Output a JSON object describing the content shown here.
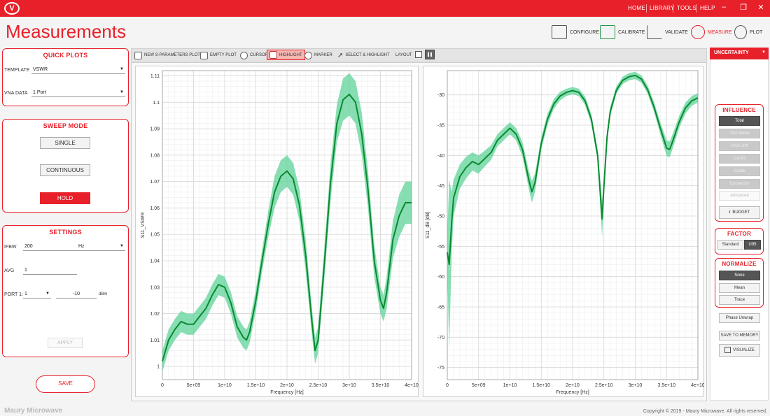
{
  "topbar": {
    "nav": [
      "HOME",
      "LIBRARY",
      "TOOLS",
      "HELP"
    ],
    "window_controls": [
      "minimize-icon",
      "restore-icon",
      "close-icon"
    ]
  },
  "page_title": "Measurements",
  "workflow": [
    {
      "label": "CONFIGURE",
      "icon": "configure-icon"
    },
    {
      "label": "CALIBRATE",
      "icon": "calibrate-icon"
    },
    {
      "label": "VALIDATE",
      "icon": "validate-icon"
    },
    {
      "label": "MEASURE",
      "icon": "measure-icon",
      "active": true
    },
    {
      "label": "PLOT",
      "icon": "plot-icon"
    }
  ],
  "quick_plots": {
    "title": "QUICK PLOTS",
    "template_label": "TEMPLATE",
    "template_value": "VSWR",
    "vna_label": "VNA DATA",
    "vna_value": "1 Port"
  },
  "sweep_mode": {
    "title": "SWEEP MODE",
    "single": "SINGLE",
    "continuous": "CONTINUOUS",
    "hold": "HOLD"
  },
  "settings": {
    "title": "SETTINGS",
    "ifbw_label": "IFBW",
    "ifbw_value": "200",
    "ifbw_unit": "Hz",
    "avg_label": "AVG",
    "avg_value": "1",
    "port_label": "PORT 1:",
    "port_value": "1",
    "power_value": "-10",
    "power_unit": "dBm",
    "apply": "APPLY"
  },
  "save": "SAVE",
  "toolbar": {
    "new_plot": "NEW S-PARAMETERS PLOT",
    "empty_plot": "EMPTY PLOT",
    "cursor": "CURSOR",
    "highlight": "HIGHLIGHT",
    "marker": "MARKER",
    "select_highlight": "SELECT & HIGHLIGHT",
    "layout": "LAYOUT"
  },
  "uncertainty": {
    "title": "UNCERTAINTY",
    "influence_title": "INFLUENCE",
    "influence": [
      "Total",
      "VNA Noise",
      "VNA Drift",
      "Cal Kit",
      "Cable",
      "Connector",
      "Advanced"
    ],
    "budget": "BUDGET",
    "factor_title": "FACTOR",
    "factor_standard": "Standard",
    "factor_u95": "U95",
    "normalize_title": "NORMALIZE",
    "normalize": [
      "None",
      "Mean",
      "Trace"
    ],
    "phase_unwrap": "Phase Unwrap",
    "save_memory": "SAVE TO MEMORY",
    "visualize": "VISUALIZE"
  },
  "footer": {
    "brand": "Maury Microwave",
    "copyright": "Copyright © 2019 - Maury Microwave. All rights reserved."
  },
  "colors": {
    "accent": "#e8202a",
    "trace": "#0a8a2e",
    "band": "#5fd39a"
  },
  "chart_data": [
    {
      "type": "line",
      "xlabel": "Frequency [Hz]",
      "ylabel": "S11_VSWR",
      "xlim": [
        0,
        40000000000
      ],
      "ylim": [
        0.995,
        1.112
      ],
      "xticks": [
        0,
        5000000000,
        10000000000,
        15000000000,
        20000000000,
        25000000000,
        30000000000,
        35000000000,
        40000000000
      ],
      "xtick_labels": [
        "0",
        "5e+09",
        "1e+10",
        "1.5e+10",
        "2e+10",
        "2.5e+10",
        "3e+10",
        "3.5e+10",
        "4e+10"
      ],
      "yticks": [
        1,
        1.01,
        1.02,
        1.03,
        1.04,
        1.05,
        1.06,
        1.07,
        1.08,
        1.09,
        1.1,
        1.11
      ],
      "ytick_labels": [
        "1",
        "1.01",
        "1.02",
        "1.03",
        "1.04",
        "1.05",
        "1.06",
        "1.07",
        "1.08",
        "1.09",
        "1.1",
        "1.11"
      ],
      "grid": true,
      "series": [
        {
          "x": [
            0,
            1000000000,
            2000000000,
            3000000000,
            4000000000,
            5000000000,
            6000000000,
            7000000000,
            8000000000,
            9000000000,
            10000000000,
            11000000000,
            12000000000,
            13000000000,
            13500000000,
            14000000000,
            15000000000,
            16000000000,
            17000000000,
            18000000000,
            19000000000,
            20000000000,
            21000000000,
            22000000000,
            23000000000,
            24000000000,
            24500000000,
            25000000000,
            26000000000,
            27000000000,
            28000000000,
            29000000000,
            30000000000,
            31000000000,
            32000000000,
            33000000000,
            34000000000,
            35000000000,
            35500000000,
            36000000000,
            37000000000,
            38000000000,
            39000000000,
            40000000000
          ],
          "y": [
            1.002,
            1.01,
            1.014,
            1.017,
            1.016,
            1.016,
            1.019,
            1.022,
            1.027,
            1.031,
            1.03,
            1.024,
            1.015,
            1.011,
            1.01,
            1.013,
            1.025,
            1.04,
            1.054,
            1.066,
            1.072,
            1.074,
            1.071,
            1.061,
            1.042,
            1.017,
            1.006,
            1.01,
            1.039,
            1.07,
            1.092,
            1.101,
            1.103,
            1.1,
            1.088,
            1.067,
            1.04,
            1.025,
            1.022,
            1.028,
            1.048,
            1.057,
            1.062,
            1.062
          ],
          "band": [
            0.004,
            0.004,
            0.004,
            0.004,
            0.004,
            0.004,
            0.004,
            0.004,
            0.004,
            0.004,
            0.004,
            0.004,
            0.004,
            0.004,
            0.004,
            0.004,
            0.004,
            0.004,
            0.005,
            0.006,
            0.006,
            0.006,
            0.006,
            0.006,
            0.006,
            0.005,
            0.005,
            0.005,
            0.006,
            0.007,
            0.007,
            0.008,
            0.008,
            0.008,
            0.008,
            0.007,
            0.006,
            0.005,
            0.005,
            0.006,
            0.007,
            0.008,
            0.008,
            0.008
          ]
        }
      ]
    },
    {
      "type": "line",
      "xlabel": "Frequency [Hz]",
      "ylabel": "S11_dB [dB]",
      "xlim": [
        0,
        40000000000
      ],
      "ylim": [
        -77,
        -26
      ],
      "xticks": [
        0,
        5000000000,
        10000000000,
        15000000000,
        20000000000,
        25000000000,
        30000000000,
        35000000000,
        40000000000
      ],
      "xtick_labels": [
        "0",
        "5e+09",
        "1e+10",
        "1.5e+10",
        "2e+10",
        "2.5e+10",
        "3e+10",
        "3.5e+10",
        "4e+10"
      ],
      "yticks": [
        -75,
        -70,
        -65,
        -60,
        -55,
        -50,
        -45,
        -40,
        -35,
        -30
      ],
      "ytick_labels": [
        "-75",
        "-70",
        "-65",
        "-60",
        "-55",
        "-50",
        "-45",
        "-40",
        "-35",
        "-30"
      ],
      "grid": true,
      "series": [
        {
          "x": [
            0,
            300000000,
            700000000,
            1000000000,
            2000000000,
            3000000000,
            4000000000,
            5000000000,
            6000000000,
            7000000000,
            8000000000,
            9000000000,
            10000000000,
            11000000000,
            12000000000,
            13000000000,
            13500000000,
            14000000000,
            15000000000,
            16000000000,
            17000000000,
            18000000000,
            19000000000,
            20000000000,
            21000000000,
            22000000000,
            23000000000,
            24000000000,
            24700000000,
            25000000000,
            25500000000,
            26000000000,
            27000000000,
            28000000000,
            29000000000,
            30000000000,
            31000000000,
            32000000000,
            33000000000,
            34000000000,
            35000000000,
            35500000000,
            36000000000,
            37000000000,
            38000000000,
            39000000000,
            40000000000
          ],
          "y": [
            -56,
            -58,
            -51,
            -47,
            -43.5,
            -42,
            -41,
            -41.5,
            -40.5,
            -39.5,
            -37.5,
            -36.5,
            -35.5,
            -36.5,
            -39,
            -44,
            -46,
            -44.5,
            -38,
            -34,
            -31.5,
            -30.2,
            -29.6,
            -29.3,
            -29.6,
            -31,
            -34,
            -40,
            -50.5,
            -45,
            -37,
            -32.8,
            -29.2,
            -27.6,
            -27,
            -26.8,
            -27.4,
            -29.2,
            -32,
            -35.5,
            -38.8,
            -39,
            -37.6,
            -34.5,
            -32.2,
            -31,
            -30.5
          ],
          "band": [
            3,
            14,
            5,
            3,
            2,
            1.8,
            1.5,
            1.5,
            1.3,
            1.2,
            1.0,
            1.0,
            1.0,
            1.0,
            1.2,
            1.5,
            1.8,
            1.5,
            1.0,
            0.9,
            0.8,
            0.7,
            0.6,
            0.6,
            0.6,
            0.7,
            0.8,
            1.0,
            3.0,
            1.5,
            1.0,
            0.8,
            0.6,
            0.6,
            0.6,
            0.6,
            0.6,
            0.7,
            0.8,
            1.0,
            1.3,
            1.3,
            1.2,
            1.0,
            0.9,
            0.8,
            0.8
          ]
        }
      ]
    }
  ]
}
